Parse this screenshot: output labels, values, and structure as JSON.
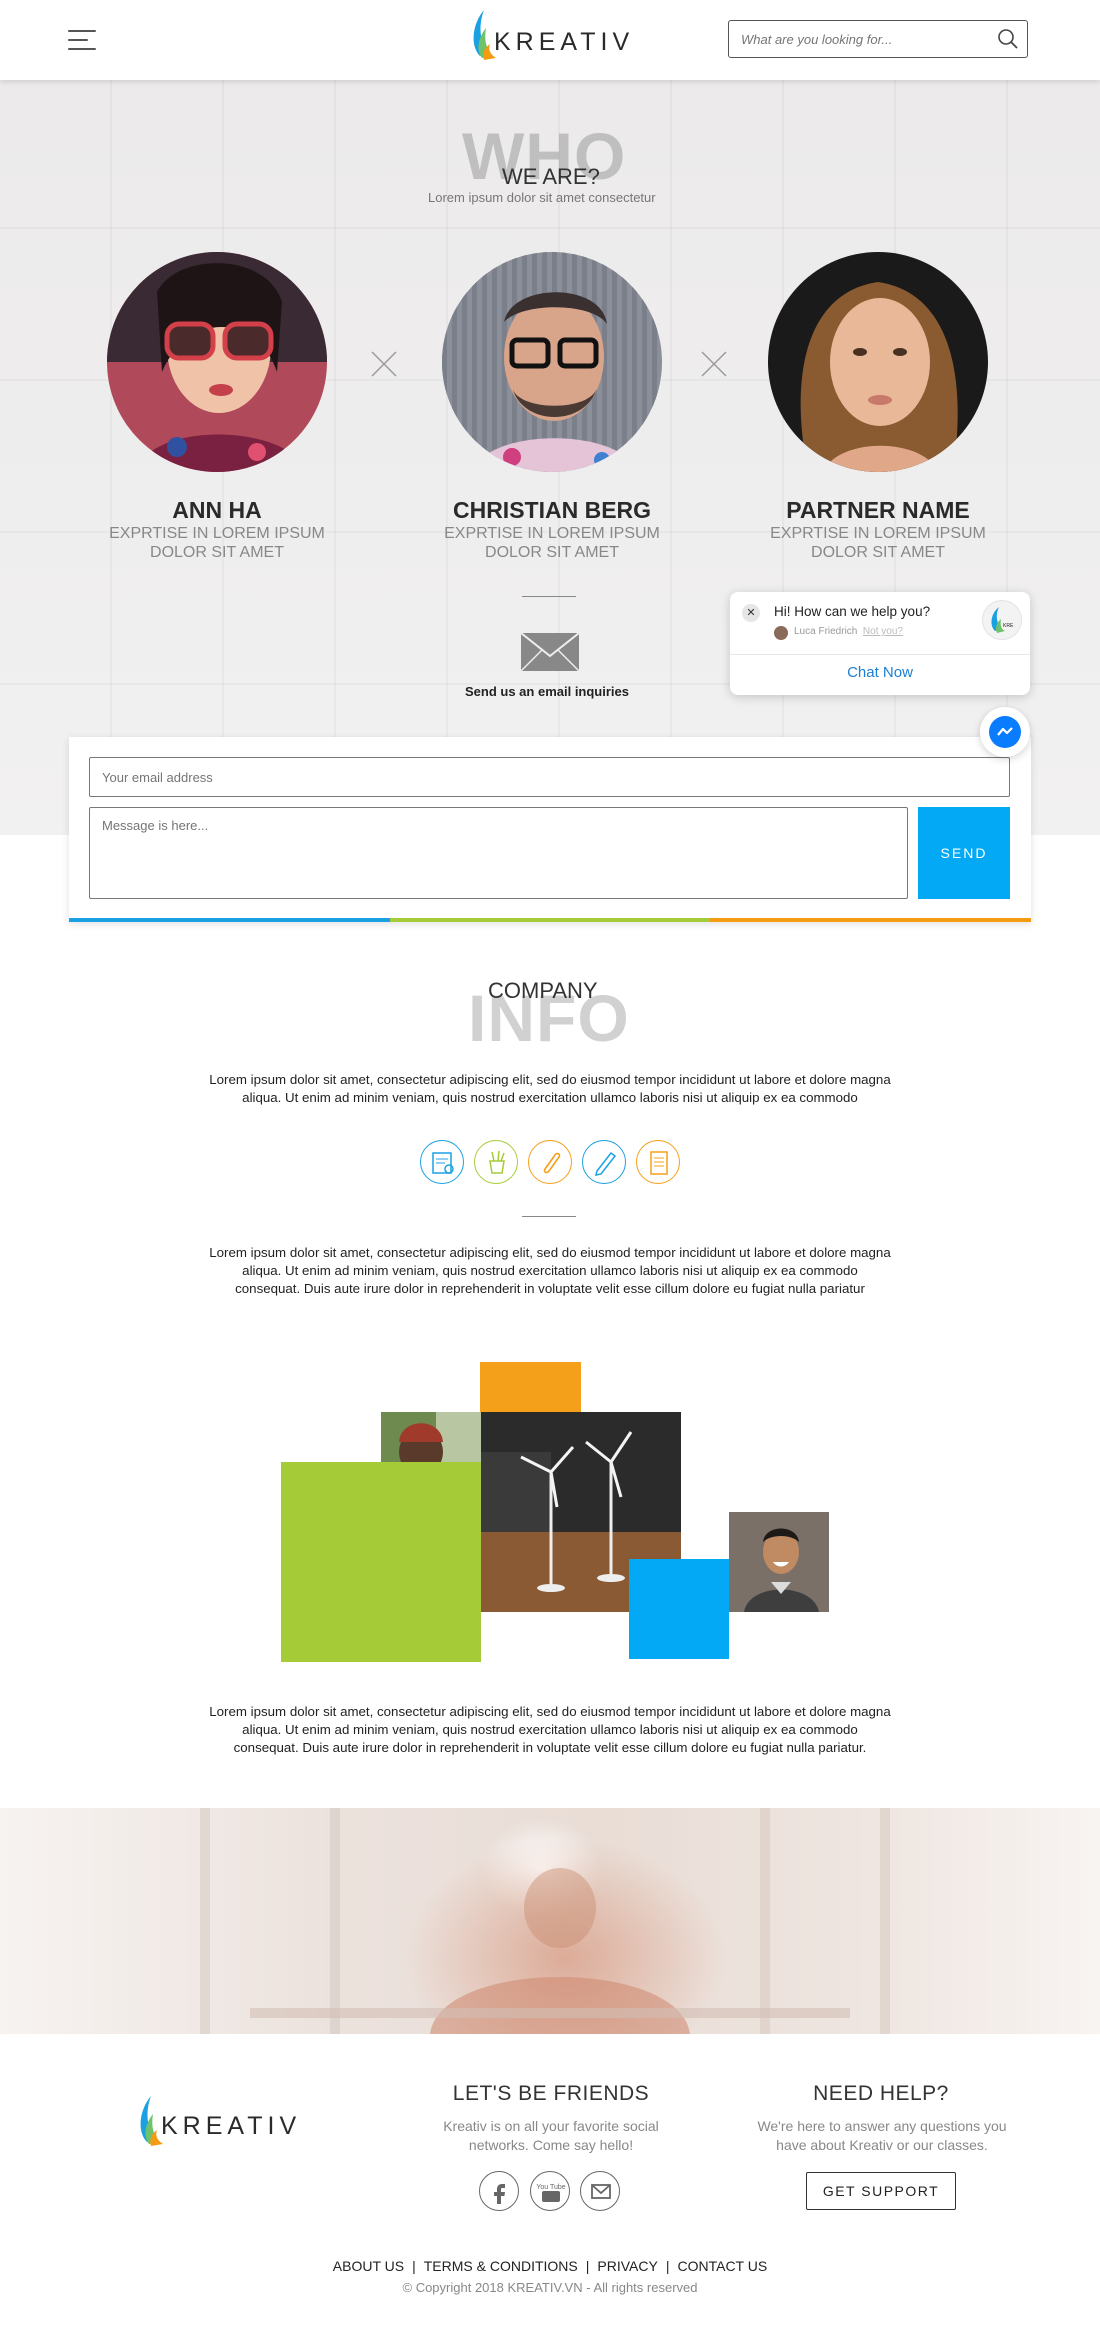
{
  "header": {
    "brand": "KREATIV",
    "search_placeholder": "What are you looking for..."
  },
  "who": {
    "big_word": "WHO",
    "subtitle": "WE ARE?",
    "lorem": "Lorem ipsum dolor sit amet consectetur",
    "people": [
      {
        "name": "ANN HA",
        "role_line1": "EXPRTISE IN LOREM IPSUM",
        "role_line2": "DOLOR SIT AMET"
      },
      {
        "name": "CHRISTIAN BERG",
        "role_line1": "EXPRTISE IN LOREM IPSUM",
        "role_line2": "DOLOR SIT AMET"
      },
      {
        "name": "PARTNER NAME",
        "role_line1": "EXPRTISE IN LOREM IPSUM",
        "role_line2": "DOLOR SIT AMET"
      }
    ],
    "email_label": "Send us an email inquiries"
  },
  "chat": {
    "greeting": "Hi! How can we help you?",
    "user_name": "Luca Friedrich",
    "not_you": "Not you?",
    "logo_text": "KRE",
    "button": "Chat Now"
  },
  "form": {
    "email_placeholder": "Your email address",
    "message_placeholder": "Message is here...",
    "send_label": "SEND",
    "accent_colors": [
      "#1ba1e2",
      "#a4cc3a",
      "#f39c12"
    ]
  },
  "company": {
    "label": "COMPANY",
    "big_word": "INFO",
    "para1": "Lorem ipsum dolor sit amet, consectetur adipiscing elit, sed do eiusmod tempor incididunt ut labore et dolore magna aliqua. Ut enim ad minim veniam, quis nostrud exercitation ullamco laboris nisi ut aliquip ex ea commodo",
    "para2": "Lorem ipsum dolor sit amet, consectetur adipiscing elit, sed do eiusmod tempor incididunt ut labore et dolore magna aliqua. Ut enim ad minim veniam, quis nostrud exercitation ullamco laboris nisi ut aliquip ex ea commodo consequat. Duis aute irure dolor in reprehenderit in voluptate velit esse cillum dolore eu fugiat nulla pariatur",
    "para3": "Lorem ipsum dolor sit amet, consectetur adipiscing elit, sed do eiusmod tempor incididunt ut labore et dolore magna aliqua. Ut enim ad minim veniam, quis nostrud exercitation ullamco laboris nisi ut aliquip ex ea commodo consequat. Duis aute irure dolor in reprehenderit in voluptate velit esse cillum dolore eu fugiat nulla pariatur.",
    "icons": [
      "certificate-icon",
      "pencil-cup-icon",
      "paperclip-icon",
      "pen-icon",
      "notebook-icon"
    ],
    "colors": {
      "blue": "#03a9f4",
      "green": "#a5cc37",
      "orange": "#f5a01a"
    }
  },
  "footer": {
    "brand": "KREATIV",
    "friends_heading": "LET'S BE FRIENDS",
    "friends_text": "Kreativ is on all your favorite social networks. Come say hello!",
    "help_heading": "NEED HELP?",
    "help_text": "We're here to answer any questions you have about Kreativ or our classes.",
    "support_label": "GET SUPPORT",
    "youtube_text": "You Tube",
    "links": [
      "ABOUT US",
      "TERMS & CONDITIONS",
      "PRIVACY",
      "CONTACT US"
    ],
    "separator": "|",
    "copyright": "© Copyright 2018 KREATIV.VN - All rights reserved"
  }
}
